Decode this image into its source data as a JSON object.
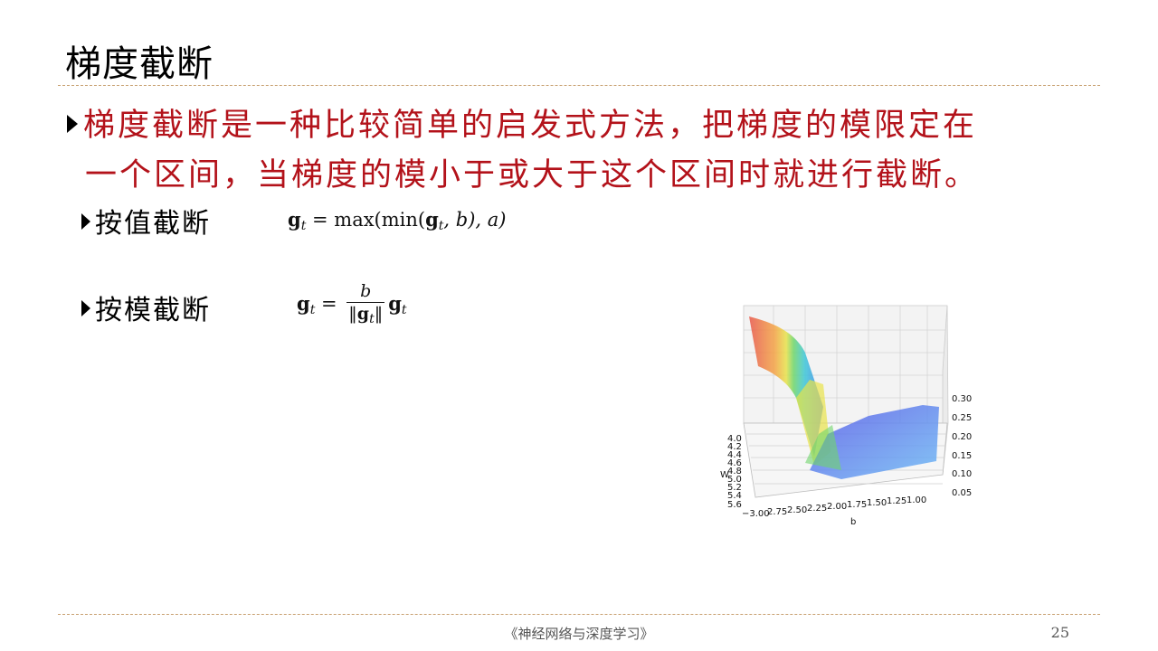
{
  "slide": {
    "title": "梯度截断",
    "bullet": {
      "line1": "梯度截断是一种比较简单的启发式方法，把梯度的模限定在",
      "line2": "一个区间，当梯度的模小于或大于这个区间时就进行截断。"
    },
    "sub_items": [
      {
        "label": "按值截断"
      },
      {
        "label": "按模截断"
      }
    ],
    "formulas": {
      "by_value": {
        "lhs": "g",
        "sub": "t",
        "eq": " = max(min(",
        "g": "g",
        "gsub": "t",
        "rest": ", b), a)"
      },
      "by_norm": {
        "lhs": "g",
        "sub": "t",
        "eq": " = ",
        "numerator": "b",
        "den_g": "g",
        "den_sub": "t",
        "rhs": "g",
        "rhs_sub": "t"
      }
    },
    "plot": {
      "xlabel": "b",
      "ylabel": "W",
      "x_ticks": [
        "−3.00",
        "2.75",
        "2.50",
        "2.25",
        "2.00",
        "1.75",
        "1.50",
        "1.25",
        "1.00"
      ],
      "y_ticks": [
        "4.0",
        "4.2",
        "4.4",
        "4.6",
        "4.8",
        "5.0",
        "5.2",
        "5.4",
        "5.6"
      ],
      "z_ticks": [
        "0.30",
        "0.25",
        "0.20",
        "0.15",
        "0.10",
        "0.05"
      ],
      "colormap": "jet"
    },
    "footer": "《神经网络与深度学习》",
    "page_number": "25"
  }
}
